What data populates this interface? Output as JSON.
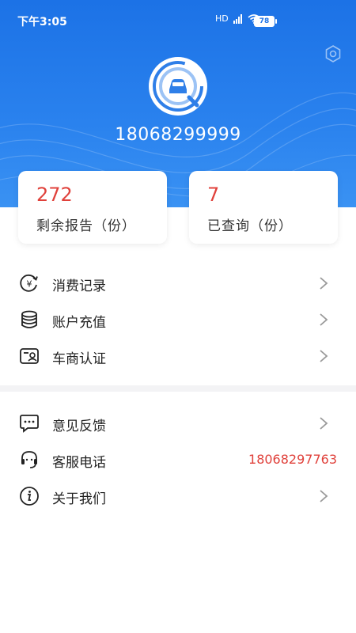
{
  "status_bar": {
    "time": "下午3:05",
    "network": "HD",
    "battery": "78"
  },
  "profile": {
    "phone": "18068299999"
  },
  "stats": [
    {
      "value": "272",
      "label": "剩余报告（份）"
    },
    {
      "value": "7",
      "label": "已查询（份）"
    }
  ],
  "menu_primary": [
    {
      "label": "消费记录",
      "icon": "yen-cycle-icon"
    },
    {
      "label": "账户充值",
      "icon": "database-icon"
    },
    {
      "label": "车商认证",
      "icon": "id-card-icon"
    }
  ],
  "menu_secondary": [
    {
      "label": "意见反馈",
      "icon": "chat-bubble-icon"
    },
    {
      "label": "客服电话",
      "icon": "headset-icon",
      "value": "18068297763"
    },
    {
      "label": "关于我们",
      "icon": "info-icon"
    }
  ],
  "colors": {
    "brand_blue": "#1c72e6",
    "accent_red": "#e0413b"
  }
}
